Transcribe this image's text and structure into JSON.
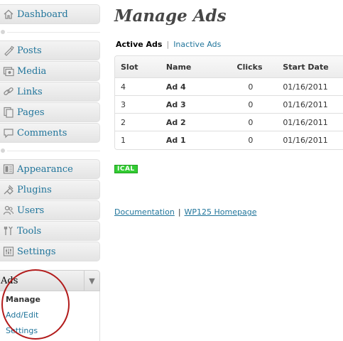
{
  "sidebar": {
    "items": [
      {
        "label": "Dashboard",
        "icon": "dashboard-icon"
      },
      {
        "label": "Posts",
        "icon": "posts-icon"
      },
      {
        "label": "Media",
        "icon": "media-icon"
      },
      {
        "label": "Links",
        "icon": "links-icon"
      },
      {
        "label": "Pages",
        "icon": "pages-icon"
      },
      {
        "label": "Comments",
        "icon": "comments-icon"
      },
      {
        "label": "Appearance",
        "icon": "appearance-icon"
      },
      {
        "label": "Plugins",
        "icon": "plugins-icon"
      },
      {
        "label": "Users",
        "icon": "users-icon"
      },
      {
        "label": "Tools",
        "icon": "tools-icon"
      },
      {
        "label": "Settings",
        "icon": "settings-icon"
      }
    ],
    "ads_menu": {
      "label": "Ads",
      "icon": "ads-gear-icon",
      "toggle_icon": "triangle-down-icon",
      "submenu": [
        {
          "label": "Manage",
          "current": true
        },
        {
          "label": "Add/Edit",
          "current": false
        },
        {
          "label": "Settings",
          "current": false
        }
      ]
    }
  },
  "main": {
    "title": "Manage Ads",
    "tabs": {
      "active": "Active Ads",
      "separator": "|",
      "inactive": "Inactive Ads"
    },
    "table": {
      "columns": [
        "Slot",
        "Name",
        "Clicks",
        "Start Date"
      ],
      "rows": [
        {
          "slot": "4",
          "name": "Ad 4",
          "clicks": "0",
          "start_date": "01/16/2011"
        },
        {
          "slot": "3",
          "name": "Ad 3",
          "clicks": "0",
          "start_date": "01/16/2011"
        },
        {
          "slot": "2",
          "name": "Ad 2",
          "clicks": "0",
          "start_date": "01/16/2011"
        },
        {
          "slot": "1",
          "name": "Ad 1",
          "clicks": "0",
          "start_date": "01/16/2011"
        }
      ]
    },
    "ical_badge": "ICAL",
    "footer": {
      "documentation": "Documentation",
      "separator": "|",
      "homepage": "WP125 Homepage"
    }
  },
  "colors": {
    "link": "#21759b",
    "title": "#464646",
    "ical_green": "#33cc33",
    "highlight_circle": "#b21b1b"
  }
}
